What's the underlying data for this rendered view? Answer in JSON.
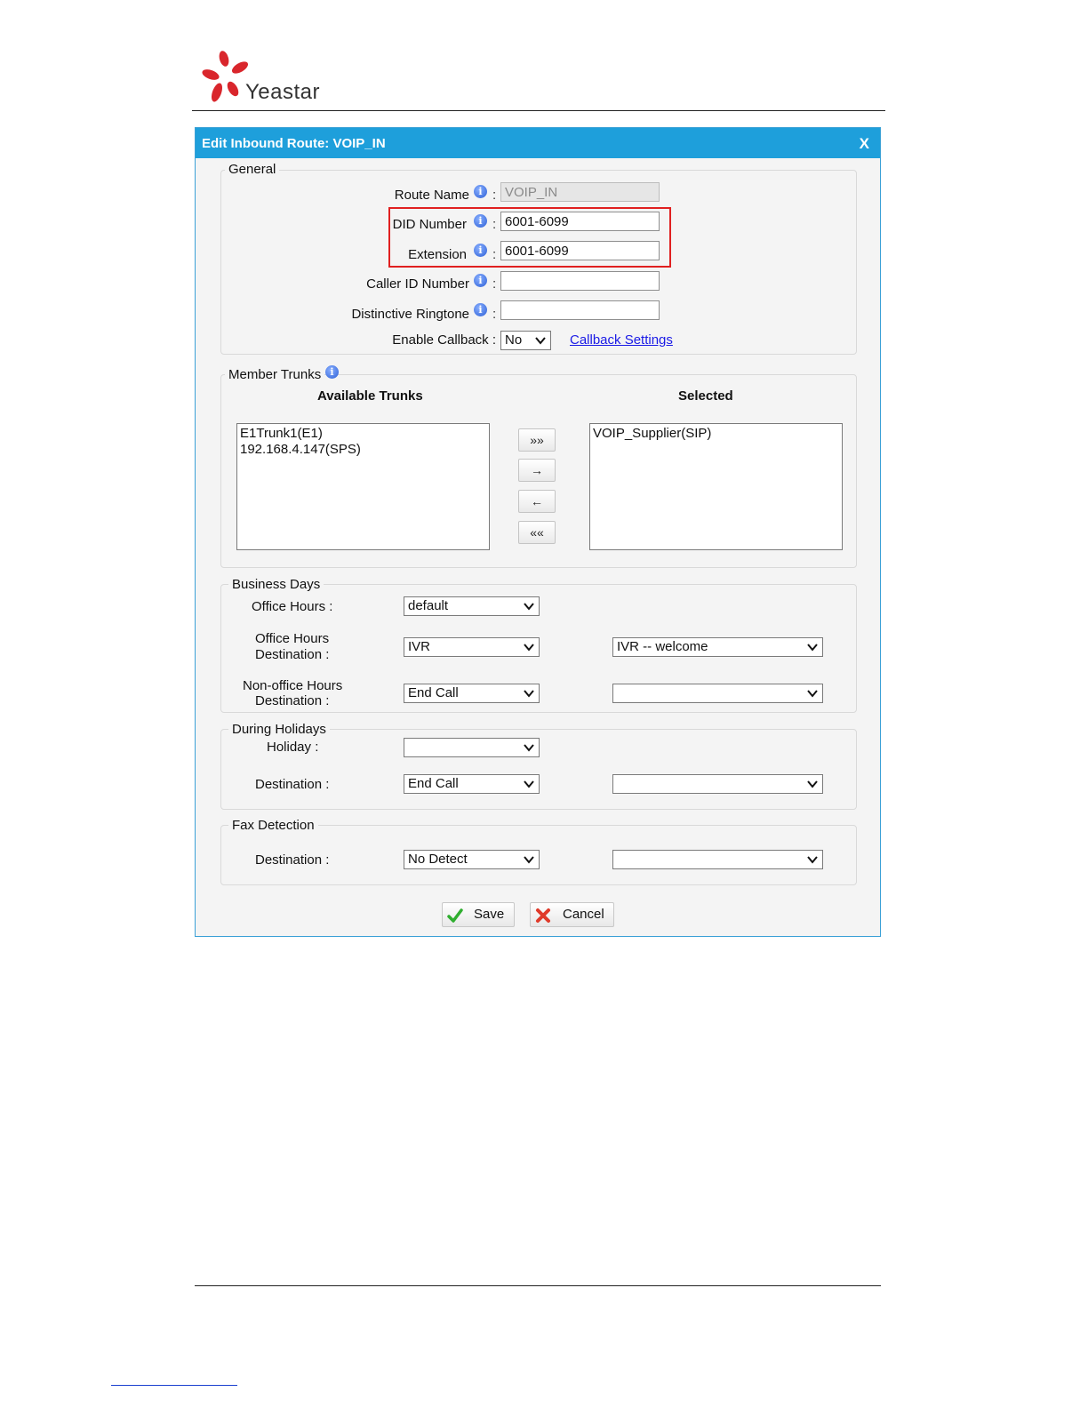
{
  "brand": {
    "name": "Yeastar",
    "logo_color": "#d9262c"
  },
  "dialog": {
    "title": "Edit Inbound Route: VOIP_IN",
    "close_label": "X",
    "accent_color": "#1e9fdb"
  },
  "general": {
    "legend": "General",
    "route_name": {
      "label": "Route Name",
      "value": "VOIP_IN"
    },
    "did_number": {
      "label": "DID Number",
      "value": "6001-6099"
    },
    "extension": {
      "label": "Extension",
      "value": "6001-6099"
    },
    "caller_id": {
      "label": "Caller ID Number",
      "value": ""
    },
    "ringtone": {
      "label": "Distinctive Ringtone",
      "value": ""
    },
    "callback": {
      "label": "Enable Callback :",
      "value": "No",
      "settings_link": "Callback Settings"
    },
    "colon": ":"
  },
  "member_trunks": {
    "legend": "Member Trunks",
    "available_header": "Available Trunks",
    "selected_header": "Selected",
    "available": [
      "E1Trunk1(E1)",
      "192.168.4.147(SPS)"
    ],
    "selected": [
      "VOIP_Supplier(SIP)"
    ],
    "buttons": {
      "add_all": "»»",
      "add": "→",
      "remove": "←",
      "remove_all": "««"
    }
  },
  "business_days": {
    "legend": "Business Days",
    "office_hours": {
      "label": "Office Hours :",
      "value": "default"
    },
    "office_dest": {
      "label_line1": "Office Hours",
      "label_line2": "Destination :",
      "value": "IVR",
      "target": "IVR -- welcome"
    },
    "nonoffice_dest": {
      "label_line1": "Non-office Hours",
      "label_line2": "Destination :",
      "value": "End Call",
      "target": ""
    }
  },
  "holidays": {
    "legend": "During Holidays",
    "holiday": {
      "label": "Holiday :",
      "value": ""
    },
    "destination": {
      "label": "Destination :",
      "value": "End Call",
      "target": ""
    }
  },
  "fax": {
    "legend": "Fax Detection",
    "destination": {
      "label": "Destination :",
      "value": "No Detect",
      "target": ""
    }
  },
  "actions": {
    "save": "Save",
    "cancel": "Cancel"
  }
}
